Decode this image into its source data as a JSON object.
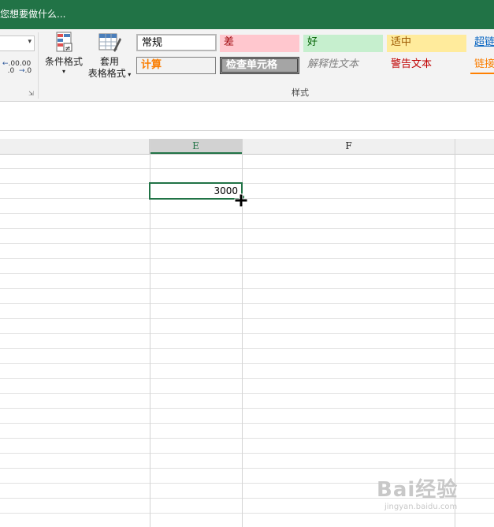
{
  "titlebar": {
    "tell_me": "您想要做什么..."
  },
  "ribbon": {
    "number_group": {
      "format_value": "",
      "dec_increase_label": ".00",
      "dec_decrease_label": ".00"
    },
    "conditional_format": {
      "label": "条件格式",
      "has_dropdown": true
    },
    "format_as_table": {
      "label_line1": "套用",
      "label_line2": "表格格式"
    },
    "styles_caption": "样式",
    "cell_styles": [
      {
        "label": "常规",
        "name": "style-normal",
        "bg": "#ffffff",
        "color": "#000000"
      },
      {
        "label": "差",
        "name": "style-bad",
        "bg": "#ffc7ce",
        "color": "#9c0006"
      },
      {
        "label": "好",
        "name": "style-good",
        "bg": "#c6efce",
        "color": "#006100"
      },
      {
        "label": "适中",
        "name": "style-neutral",
        "bg": "#ffeb9c",
        "color": "#9c5700"
      },
      {
        "label": "超链",
        "name": "style-hyperlink",
        "bg": "#f3f3f3",
        "color": "#0563c1"
      },
      {
        "label": "计算",
        "name": "style-calculation",
        "bg": "#f2f2f2",
        "color": "#fa7d00"
      },
      {
        "label": "检查单元格",
        "name": "style-check-cell",
        "bg": "#a5a5a5",
        "color": "#ffffff"
      },
      {
        "label": "解释性文本",
        "name": "style-explanatory",
        "bg": "#f3f3f3",
        "color": "#7f7f7f"
      },
      {
        "label": "警告文本",
        "name": "style-warning",
        "bg": "#f3f3f3",
        "color": "#c00000"
      },
      {
        "label": "链接",
        "name": "style-linked-cell",
        "bg": "#f3f3f3",
        "color": "#fa7d00"
      }
    ]
  },
  "sheet": {
    "columns": [
      "E",
      "F"
    ],
    "selected_column": "E",
    "active_cell_value": "3000"
  },
  "watermark": {
    "text": "Bai经验",
    "sub": "jingyan.baidu.com"
  },
  "colors": {
    "accent": "#217346"
  }
}
